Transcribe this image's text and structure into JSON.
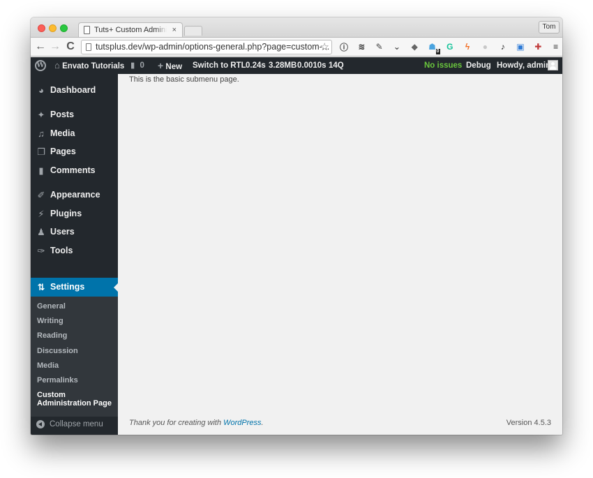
{
  "browser": {
    "tab_title": "Tuts+ Custom Administration Page",
    "tab_close": "×",
    "profile_name": "Tom",
    "url": "tutsplus.dev/wp-admin/options-general.php?page=custom-...",
    "nav": {
      "back": "←",
      "forward": "→",
      "reload": "C"
    },
    "star": "☆",
    "extensions": [
      {
        "name": "1password-icon",
        "glyph": "ⓘ",
        "color": "#444444"
      },
      {
        "name": "buffer-icon",
        "glyph": "≋",
        "color": "#222222"
      },
      {
        "name": "evernote-icon",
        "glyph": "✎",
        "color": "#444444"
      },
      {
        "name": "pocket-icon",
        "glyph": "⌄",
        "color": "#555555"
      },
      {
        "name": "layers-icon",
        "glyph": "◆",
        "color": "#666666"
      },
      {
        "name": "ghostery-icon",
        "glyph": "☗",
        "color": "#4aa3df",
        "badge": "0"
      },
      {
        "name": "grammarly-icon",
        "glyph": "G",
        "color": "#15c39a"
      },
      {
        "name": "bolt-icon",
        "glyph": "ϟ",
        "color": "#f36c21"
      },
      {
        "name": "disabled-extension-icon",
        "glyph": "●",
        "color": "#c8c8c8"
      },
      {
        "name": "music-note-icon",
        "glyph": "♪",
        "color": "#222222"
      },
      {
        "name": "window-extension-icon",
        "glyph": "▣",
        "color": "#2d7ad6"
      },
      {
        "name": "clock-extension-icon",
        "glyph": "✚",
        "color": "#c03a3a"
      },
      {
        "name": "menu-icon",
        "glyph": "≡",
        "color": "#333333"
      }
    ]
  },
  "adminbar": {
    "site_name": "Envato Tutorials",
    "comments_count": "0",
    "new_label": "New",
    "rtl_label": "Switch to RTL",
    "stats": {
      "time": "0.24s",
      "memory": "3.28MB",
      "query_time": "0.0010s",
      "queries": "14Q"
    },
    "status": "No issues",
    "debug_label": "Debug",
    "greeting": "Howdy, admin"
  },
  "sidebar": {
    "items": [
      {
        "label": "Dashboard",
        "icon": "dashboard-icon",
        "glyph": "◕"
      },
      {
        "label": "Posts",
        "icon": "pin-icon",
        "glyph": "✦"
      },
      {
        "label": "Media",
        "icon": "media-icon",
        "glyph": "♫"
      },
      {
        "label": "Pages",
        "icon": "pages-icon",
        "glyph": "❐"
      },
      {
        "label": "Comments",
        "icon": "comment-icon",
        "glyph": "▮"
      },
      {
        "label": "Appearance",
        "icon": "brush-icon",
        "glyph": "✐"
      },
      {
        "label": "Plugins",
        "icon": "plugin-icon",
        "glyph": "⚡"
      },
      {
        "label": "Users",
        "icon": "user-icon",
        "glyph": "♟"
      },
      {
        "label": "Tools",
        "icon": "wrench-icon",
        "glyph": "✑"
      },
      {
        "label": "Settings",
        "icon": "settings-icon",
        "glyph": "⇅"
      }
    ],
    "submenu": [
      {
        "label": "General"
      },
      {
        "label": "Writing"
      },
      {
        "label": "Reading"
      },
      {
        "label": "Discussion"
      },
      {
        "label": "Media"
      },
      {
        "label": "Permalinks"
      },
      {
        "label": "Custom Administration Page"
      }
    ],
    "collapse_label": "Collapse menu"
  },
  "content": {
    "body_text": "This is the basic submenu page.",
    "footer_prefix": "Thank you for creating with ",
    "footer_link": "WordPress",
    "footer_suffix": ".",
    "version": "Version 4.5.3"
  },
  "colors": {
    "adminbar_bg": "#23282d",
    "active_menu": "#0073aa",
    "status_ok": "#6ac63d",
    "link": "#0073aa"
  }
}
